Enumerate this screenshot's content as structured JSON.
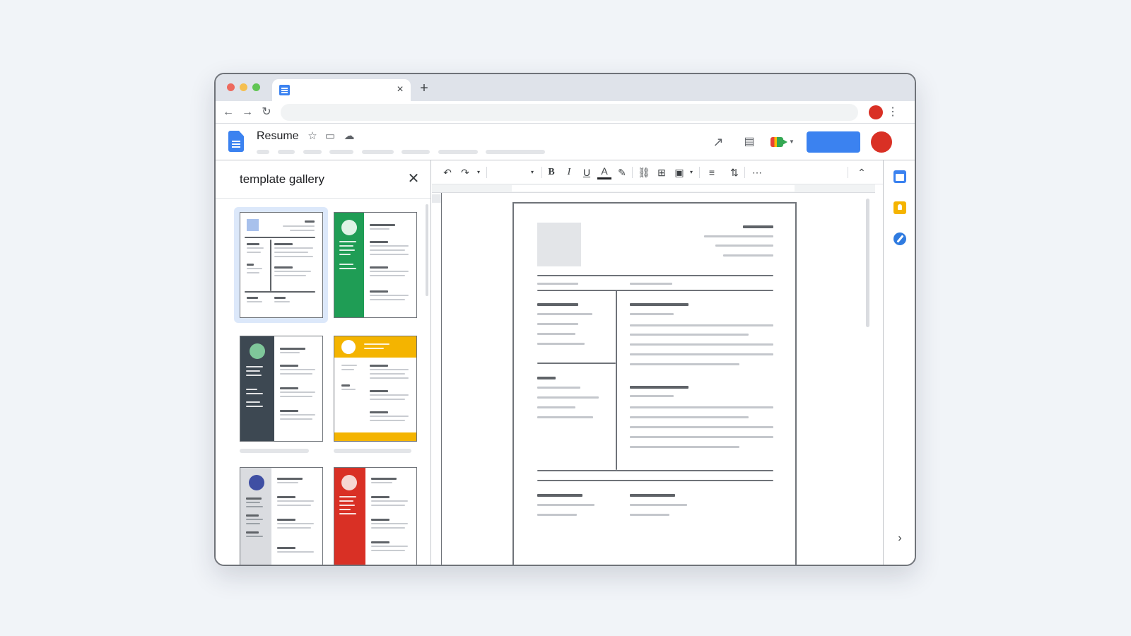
{
  "browser": {
    "tab_close_glyph": "×",
    "new_tab_glyph": "+",
    "back_glyph": "←",
    "forward_glyph": "→",
    "reload_glyph": "↻",
    "menu_glyph": "⋮",
    "profile_color": "#d93025",
    "traffic_lights": [
      "#ed6a5e",
      "#f5bf4f",
      "#61c554"
    ]
  },
  "docs": {
    "title": "Resume",
    "share_button_color": "#3b82f0",
    "avatar_color": "#d93025",
    "icons": {
      "star": "☆",
      "move_to_folder": "▭",
      "cloud_status": "☁",
      "activity": "↗",
      "comments": "▤"
    }
  },
  "gallery": {
    "title": "template gallery",
    "close_glyph": "✕",
    "templates": [
      {
        "style": "light-grid",
        "accent": "#a8c1ec",
        "selected": true
      },
      {
        "style": "sidebar",
        "accent": "#1f9d55",
        "circle": "#dff3e6"
      },
      {
        "style": "sidebar",
        "accent": "#3d4852",
        "circle": "#7fc79a"
      },
      {
        "style": "header",
        "accent": "#f4b400",
        "circle": "#ffffff"
      },
      {
        "style": "sidebar-light",
        "accent": "#dadce0",
        "circle": "#3f4fa3"
      },
      {
        "style": "sidebar",
        "accent": "#d93025",
        "circle": "#f6d7d3"
      }
    ]
  },
  "toolbar": {
    "undo": "↶",
    "redo": "↷",
    "dropdown": "▾",
    "bold": "B",
    "italic": "I",
    "underline": "U",
    "text_color": "A",
    "highlight": "✎",
    "link": "⛓",
    "comment": "⊞",
    "image": "▣",
    "align": "≡",
    "line_spacing": "⇅",
    "more": "⋯",
    "collapse": "⌃"
  },
  "side_panel": {
    "expand_glyph": "›",
    "apps": [
      "calendar-icon",
      "keep-icon",
      "tasks-icon"
    ]
  }
}
